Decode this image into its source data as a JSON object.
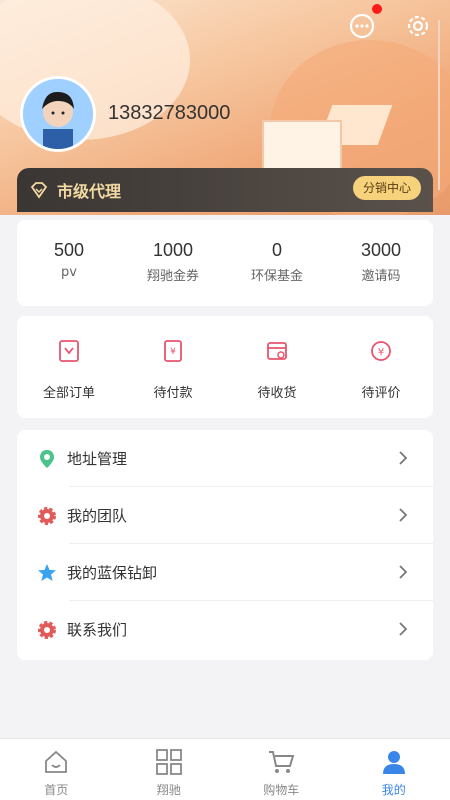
{
  "header": {
    "phone": "13832783000",
    "message_icon": "chat-bubble-icon",
    "settings_icon": "gear-icon",
    "avatar_icon": "user-avatar-icon",
    "hero_bg_colors": [
      "#fbe7d3",
      "#f7c9a3",
      "#f0a878",
      "#e89a6a"
    ]
  },
  "vip": {
    "title": "市级代理",
    "button": "分销中心",
    "icon": "diamond-icon"
  },
  "stats": [
    {
      "value": "500",
      "label": "pv"
    },
    {
      "value": "1000",
      "label": "翔驰金券"
    },
    {
      "value": "0",
      "label": "环保基金"
    },
    {
      "value": "3000",
      "label": "邀请码"
    }
  ],
  "orders": [
    {
      "label": "全部订单",
      "icon": "all-orders-icon"
    },
    {
      "label": "待付款",
      "icon": "pending-payment-icon"
    },
    {
      "label": "待收货",
      "icon": "pending-receipt-icon"
    },
    {
      "label": "待评价",
      "icon": "pending-review-icon"
    }
  ],
  "menu": [
    {
      "label": "地址管理",
      "icon": "location-pin-icon"
    },
    {
      "label": "我的团队",
      "icon": "gear-icon"
    },
    {
      "label": "我的蓝保钻卸",
      "icon": "star-icon"
    },
    {
      "label": "联系我们",
      "icon": "gear-icon"
    }
  ],
  "tabbar": [
    {
      "label": "首页",
      "icon": "home-icon",
      "active": false
    },
    {
      "label": "翔驰",
      "icon": "grid-icon",
      "active": false
    },
    {
      "label": "购物车",
      "icon": "cart-icon",
      "active": false
    },
    {
      "label": "我的",
      "icon": "profile-icon",
      "active": true
    }
  ],
  "colors": {
    "accent": "#3a86e8",
    "order_icon": "#e8556f",
    "vip_gold": "#f6d27c"
  }
}
